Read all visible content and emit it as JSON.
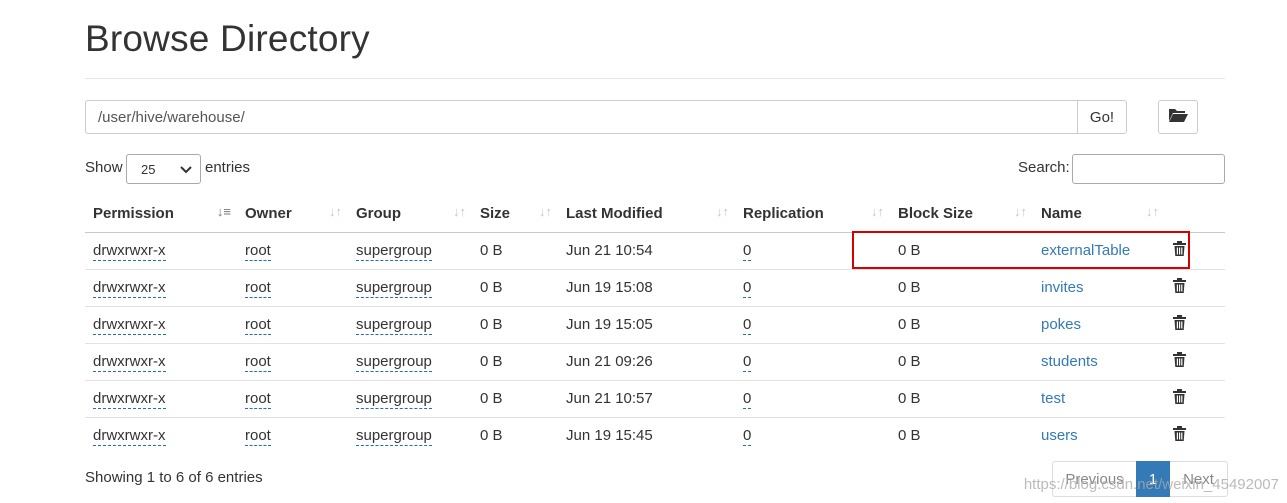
{
  "page": {
    "title": "Browse Directory"
  },
  "pathbar": {
    "path_value": "/user/hive/warehouse/",
    "go_label": "Go!"
  },
  "length": {
    "show_label": "Show",
    "selected": "25",
    "entries_label": "entries"
  },
  "search": {
    "label": "Search:",
    "value": ""
  },
  "table": {
    "headers": [
      "Permission",
      "Owner",
      "Group",
      "Size",
      "Last Modified",
      "Replication",
      "Block Size",
      "Name"
    ],
    "rows": [
      {
        "permission": "drwxrwxr-x",
        "owner": "root",
        "group": "supergroup",
        "size": "0 B",
        "modified": "Jun 21 10:54",
        "replication": "0",
        "block_size": "0 B",
        "name": "externalTable"
      },
      {
        "permission": "drwxrwxr-x",
        "owner": "root",
        "group": "supergroup",
        "size": "0 B",
        "modified": "Jun 19 15:08",
        "replication": "0",
        "block_size": "0 B",
        "name": "invites"
      },
      {
        "permission": "drwxrwxr-x",
        "owner": "root",
        "group": "supergroup",
        "size": "0 B",
        "modified": "Jun 19 15:05",
        "replication": "0",
        "block_size": "0 B",
        "name": "pokes"
      },
      {
        "permission": "drwxrwxr-x",
        "owner": "root",
        "group": "supergroup",
        "size": "0 B",
        "modified": "Jun 21 09:26",
        "replication": "0",
        "block_size": "0 B",
        "name": "students"
      },
      {
        "permission": "drwxrwxr-x",
        "owner": "root",
        "group": "supergroup",
        "size": "0 B",
        "modified": "Jun 21 10:57",
        "replication": "0",
        "block_size": "0 B",
        "name": "test"
      },
      {
        "permission": "drwxrwxr-x",
        "owner": "root",
        "group": "supergroup",
        "size": "0 B",
        "modified": "Jun 19 15:45",
        "replication": "0",
        "block_size": "0 B",
        "name": "users"
      }
    ]
  },
  "footer": {
    "info": "Showing 1 to 6 of 6 entries",
    "prev_label": "Previous",
    "current_page": "1",
    "next_label": "Next",
    "watermark": "https://blog.csdn.net/weixin_45492007"
  },
  "icons": {
    "folder": "folder-open-icon",
    "trash": "trash-icon",
    "sort": "sort-icon",
    "sort_active": "sort-ascending-icon",
    "dropdown": "chevron-down-icon"
  },
  "colors": {
    "link": "#337ab7",
    "highlight_box": "#d60000",
    "page_active": "#337ab7"
  }
}
